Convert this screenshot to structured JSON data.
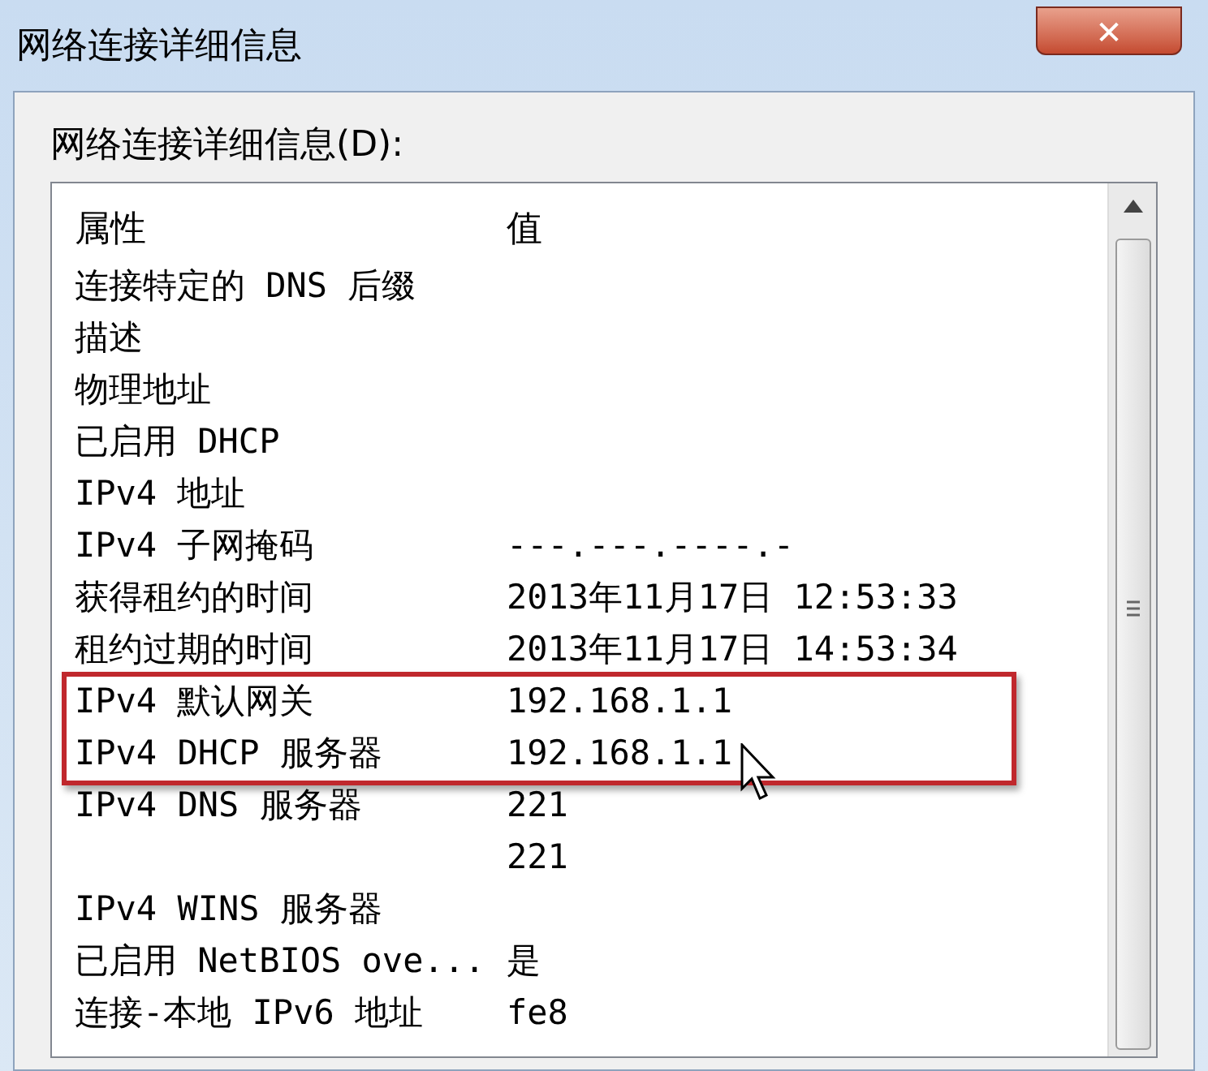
{
  "window": {
    "title": "网络连接详细信息",
    "close": "✕"
  },
  "list_label": "网络连接详细信息(D):",
  "columns": [
    "属性",
    "值"
  ],
  "rows": [
    {
      "property": "连接特定的 DNS 后缀",
      "value": "",
      "highlighted": false
    },
    {
      "property": "描述",
      "value": "",
      "highlighted": false
    },
    {
      "property": "物理地址",
      "value": "",
      "highlighted": false
    },
    {
      "property": "已启用 DHCP",
      "value": "",
      "highlighted": false
    },
    {
      "property": "IPv4 地址",
      "value": "",
      "highlighted": false
    },
    {
      "property": "IPv4 子网掩码",
      "value": "---.---.----.-",
      "highlighted": false
    },
    {
      "property": "获得租约的时间",
      "value": "2013年11月17日 12:53:33",
      "highlighted": false
    },
    {
      "property": "租约过期的时间",
      "value": "2013年11月17日 14:53:34",
      "highlighted": false
    },
    {
      "property": "IPv4 默认网关",
      "value": "192.168.1.1",
      "highlighted": true
    },
    {
      "property": "IPv4 DHCP 服务器",
      "value": "192.168.1.1",
      "highlighted": true
    },
    {
      "property": "IPv4 DNS 服务器",
      "value": "221",
      "highlighted": false
    },
    {
      "property": "",
      "value": "221",
      "highlighted": false
    },
    {
      "property": "IPv4 WINS 服务器",
      "value": "",
      "highlighted": false
    },
    {
      "property": "已启用 NetBIOS ove...",
      "value": "是",
      "highlighted": false
    },
    {
      "property": "连接-本地 IPv6 地址",
      "value": "fe8",
      "highlighted": false
    }
  ]
}
